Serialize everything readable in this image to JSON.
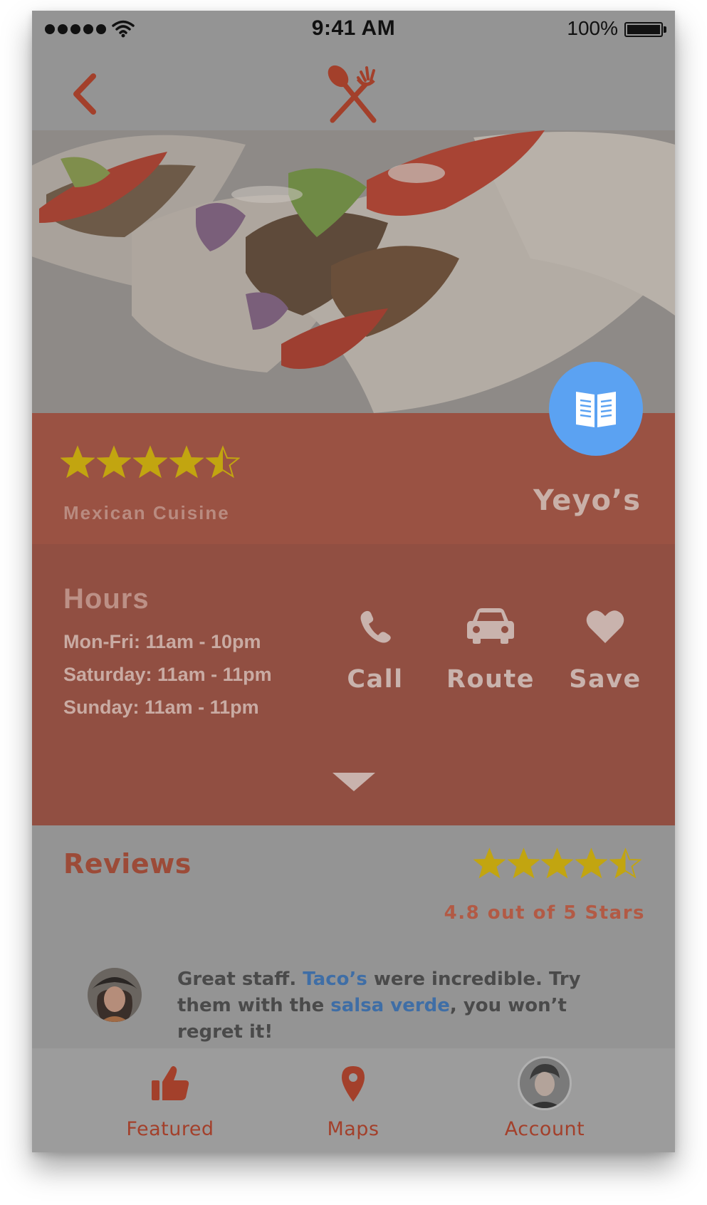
{
  "status_bar": {
    "time": "9:41 AM",
    "battery": "100%"
  },
  "nav": {
    "back_icon": "chevron-left-icon",
    "logo_icon": "spoon-fork-icon"
  },
  "hero": {
    "image": "tacos-photo",
    "menu_icon": "open-book-icon"
  },
  "restaurant": {
    "rating_value": 4.5,
    "cuisine": "Mexican Cuisine",
    "name": "Yeyo’s"
  },
  "hours": {
    "title": "Hours",
    "lines": [
      "Mon-Fri: 11am - 10pm",
      "Saturday: 11am - 11pm",
      "Sunday: 11am - 11pm"
    ]
  },
  "actions": {
    "call": "Call",
    "route": "Route",
    "save": "Save"
  },
  "reviews": {
    "title": "Reviews",
    "rating_value": 4.5,
    "score_text": "4.8 out of 5 Stars",
    "items": [
      {
        "segments": [
          "Great staff. ",
          "Taco’s",
          " were incredible. Try them with the ",
          "salsa verde",
          ", you won’t regret it!"
        ]
      }
    ]
  },
  "tabbar": {
    "featured": "Featured",
    "maps": "Maps",
    "account": "Account"
  },
  "colors": {
    "accent": "#a3402b",
    "band": "#9a5243",
    "band_dark": "#914f42",
    "star": "#c2a510",
    "menu_button": "#5ba2f2",
    "link": "#3f6ea6"
  }
}
